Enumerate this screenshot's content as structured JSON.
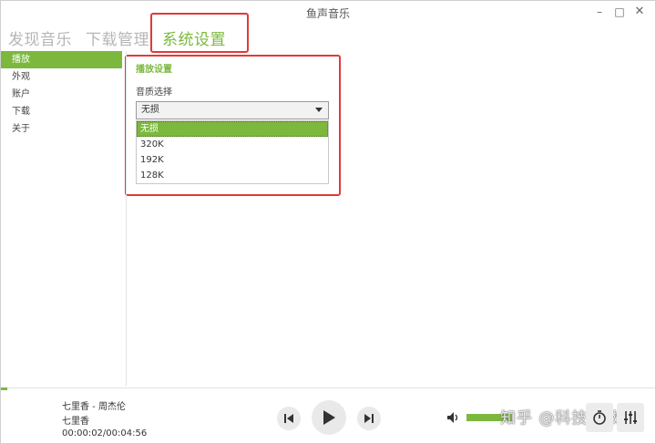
{
  "window": {
    "title": "鱼声音乐"
  },
  "window_controls": {
    "minimize": "–",
    "maximize": "□",
    "close": "✕"
  },
  "topnav": {
    "tabs": [
      {
        "label": "发现音乐"
      },
      {
        "label": "下载管理"
      },
      {
        "label": "系统设置",
        "active": true
      }
    ]
  },
  "sidebar": {
    "items": [
      {
        "label": "播放",
        "active": true
      },
      {
        "label": "外观"
      },
      {
        "label": "账户"
      },
      {
        "label": "下载"
      },
      {
        "label": "关于"
      }
    ]
  },
  "settings": {
    "section_title": "播放设置",
    "quality_label": "音质选择",
    "quality_selected": "无损",
    "quality_options": [
      "无损",
      "320K",
      "192K",
      "128K"
    ]
  },
  "player": {
    "song_title": "七里香 - 周杰伦",
    "album": "七里香",
    "time": "00:00:02/00:04:56",
    "progress": 0.01,
    "volume": 1.0
  },
  "watermark": "知乎 @科技指数",
  "colors": {
    "accent": "#7cb83e",
    "annotation": "#e03a3a"
  },
  "icons": [
    "skip-previous-icon",
    "play-icon",
    "skip-next-icon",
    "volume-icon",
    "timer-icon",
    "equalizer-icon"
  ]
}
